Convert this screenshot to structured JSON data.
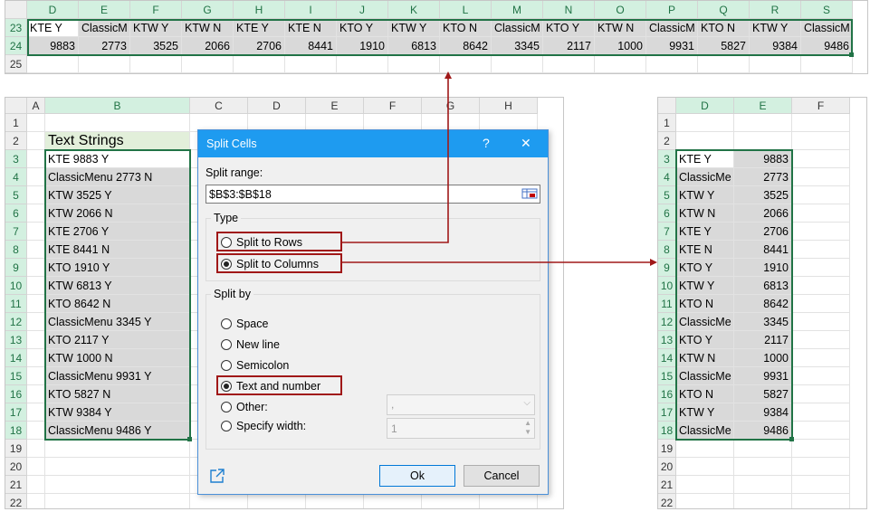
{
  "top_sheet": {
    "columns": [
      "D",
      "E",
      "F",
      "G",
      "H",
      "I",
      "J",
      "K",
      "L",
      "M",
      "N",
      "O",
      "P",
      "Q",
      "R",
      "S"
    ],
    "rows": [
      {
        "num": "23",
        "cells": [
          "KTE Y",
          "ClassicM",
          "KTW Y",
          "KTW N",
          "KTE Y",
          "KTE N",
          "KTO Y",
          "KTW Y",
          "KTO N",
          "ClassicM",
          "KTO Y",
          "KTW N",
          "ClassicM",
          "KTO N",
          "KTW Y",
          "ClassicM"
        ]
      },
      {
        "num": "24",
        "cells": [
          "9883",
          "2773",
          "3525",
          "2066",
          "2706",
          "8441",
          "1910",
          "6813",
          "8642",
          "3345",
          "2117",
          "1000",
          "9931",
          "5827",
          "9384",
          "9486"
        ]
      },
      {
        "num": "25",
        "cells": []
      }
    ]
  },
  "left_sheet": {
    "columns": [
      "A",
      "B",
      "C",
      "D",
      "E",
      "F",
      "G",
      "H"
    ],
    "row_numbers": [
      "1",
      "2",
      "3",
      "4",
      "5",
      "6",
      "7",
      "8",
      "9",
      "10",
      "11",
      "12",
      "13",
      "14",
      "15",
      "16",
      "17",
      "18",
      "19",
      "20",
      "21",
      "22"
    ],
    "header_cell": "Text Strings",
    "values": [
      "KTE 9883 Y",
      "ClassicMenu 2773 N",
      "KTW 3525 Y",
      "KTW 2066 N",
      "KTE 2706 Y",
      "KTE 8441 N",
      "KTO 1910 Y",
      "KTW 6813 Y",
      "KTO 8642 N",
      "ClassicMenu 3345 Y",
      "KTO 2117 Y",
      "KTW 1000 N",
      "ClassicMenu 9931 Y",
      "KTO 5827 N",
      "KTW 9384 Y",
      "ClassicMenu 9486 Y"
    ]
  },
  "right_sheet": {
    "columns": [
      "D",
      "E",
      "F"
    ],
    "row_numbers": [
      "1",
      "2",
      "3",
      "4",
      "5",
      "6",
      "7",
      "8",
      "9",
      "10",
      "11",
      "12",
      "13",
      "14",
      "15",
      "16",
      "17",
      "18",
      "19",
      "20",
      "21",
      "22"
    ],
    "rows": [
      [
        "KTE Y",
        "9883"
      ],
      [
        "ClassicMe",
        "2773"
      ],
      [
        "KTW Y",
        "3525"
      ],
      [
        "KTW N",
        "2066"
      ],
      [
        "KTE Y",
        "2706"
      ],
      [
        "KTE N",
        "8441"
      ],
      [
        "KTO Y",
        "1910"
      ],
      [
        "KTW Y",
        "6813"
      ],
      [
        "KTO N",
        "8642"
      ],
      [
        "ClassicMe",
        "3345"
      ],
      [
        "KTO Y",
        "2117"
      ],
      [
        "KTW N",
        "1000"
      ],
      [
        "ClassicMe",
        "9931"
      ],
      [
        "KTO N",
        "5827"
      ],
      [
        "KTW Y",
        "9384"
      ],
      [
        "ClassicMe",
        "9486"
      ]
    ]
  },
  "dialog": {
    "title": "Split Cells",
    "help_label": "?",
    "close_label": "✕",
    "range_label": "Split range:",
    "range_value": "$B$3:$B$18",
    "type_label": "Type",
    "type_options": [
      "Split to Rows",
      "Split to Columns"
    ],
    "type_selected": "Split to Columns",
    "splitby_label": "Split by",
    "splitby_options": [
      "Space",
      "New line",
      "Semicolon",
      "Text and number",
      "Other:",
      "Specify width:"
    ],
    "splitby_selected": "Text and number",
    "other_value": ",",
    "width_value": "1",
    "ok_label": "Ok",
    "cancel_label": "Cancel"
  },
  "colors": {
    "excel_green": "#217346",
    "highlight_red": "#a01818",
    "title_blue": "#1e9bf0",
    "shade": "#d9d9d9",
    "header_fill": "#e2efda"
  }
}
